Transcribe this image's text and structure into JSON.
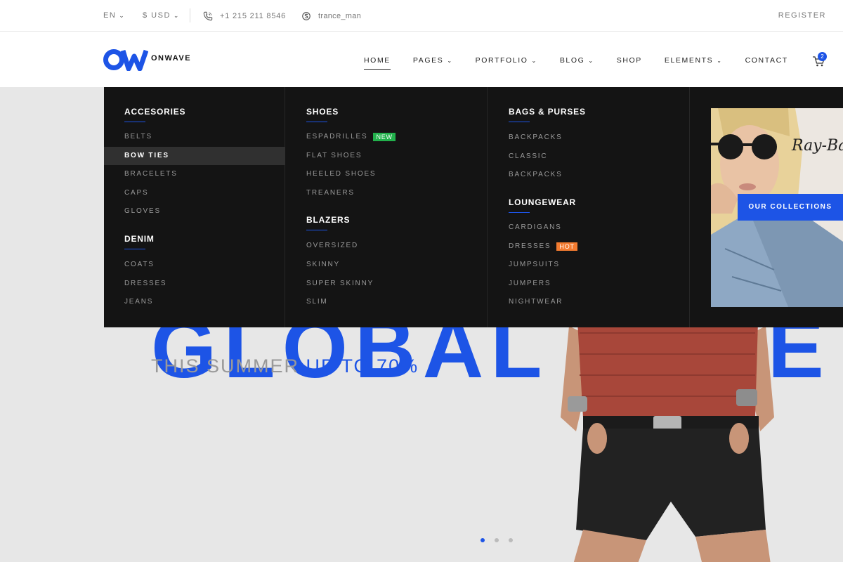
{
  "topbar": {
    "language": "EN",
    "currency": "$ USD",
    "phone": "+1 215 211 8546",
    "skype": "trance_man",
    "register": "REGISTER"
  },
  "header": {
    "logo_text": "ONWAVE",
    "nav": [
      {
        "label": "HOME",
        "active": true,
        "dropdown": false
      },
      {
        "label": "PAGES",
        "dropdown": true
      },
      {
        "label": "PORTFOLIO",
        "dropdown": true
      },
      {
        "label": "BLOG",
        "dropdown": true
      },
      {
        "label": "SHOP",
        "dropdown": false
      },
      {
        "label": "ELEMENTS",
        "dropdown": true
      },
      {
        "label": "CONTACT",
        "dropdown": false
      }
    ],
    "cart_count": "2"
  },
  "hero": {
    "headline_partial": "GLOBAL SALE",
    "sub_grey": "THIS SUMMER",
    "sub_blue": "UP TO 70%",
    "slides": 3,
    "active_slide": 1
  },
  "mega_menu": {
    "col1": {
      "accessories_title": "ACCESORIES",
      "accessories": [
        "BELTS",
        "BOW TIES",
        "BRACELETS",
        "CAPS",
        "GLOVES"
      ],
      "denim_title": "DENIM",
      "denim": [
        "COATS",
        "DRESSES",
        "JEANS"
      ]
    },
    "col2": {
      "shoes_title": "SHOES",
      "shoes": [
        "ESPADRILLES",
        "FLAT SHOES",
        "HEELED SHOES",
        "TREANERS"
      ],
      "new_badge": "NEW",
      "blazers_title": "BLAZERS",
      "blazers": [
        "OVERSIZED",
        "SKINNY",
        "SUPER SKINNY",
        "SLIM"
      ]
    },
    "col3": {
      "bags_title": "BAGS & PURSES",
      "bags": [
        "BACKPACKS",
        "CLASSIC",
        "BACKPACKS"
      ],
      "lounge_title": "LOUNGEWEAR",
      "lounge": [
        "CARDIGANS",
        "DRESSES",
        "JUMPSUITS",
        "JUMPERS",
        "NIGHTWEAR"
      ],
      "hot_badge": "HOT"
    },
    "promo": {
      "brand": "Ray-Ban",
      "button": "OUR COLLECTIONS"
    }
  },
  "colors": {
    "accent": "#1d54e6",
    "menu_bg": "#141414",
    "new_badge": "#22b14c",
    "hot_badge": "#f27b30"
  }
}
